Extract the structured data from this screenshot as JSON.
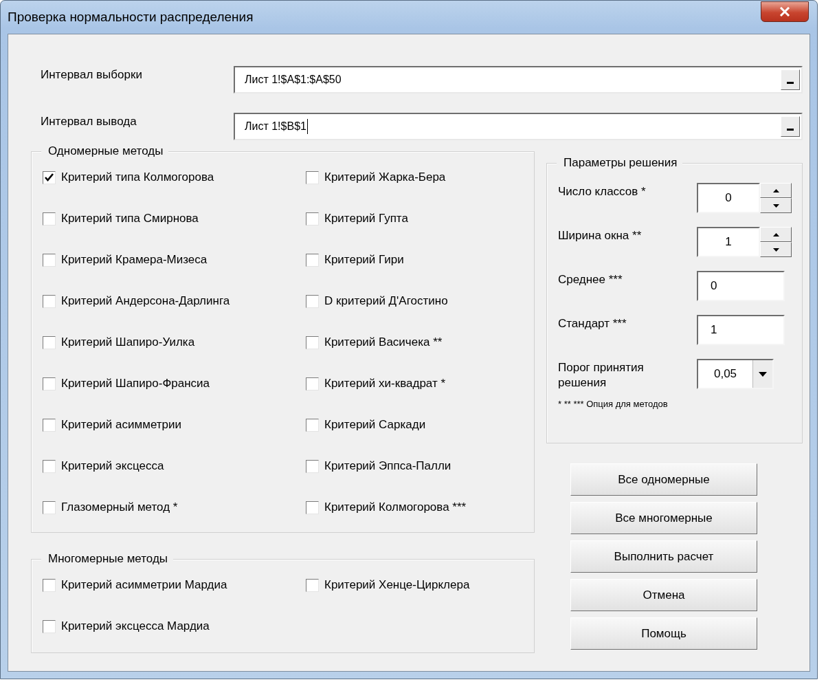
{
  "window": {
    "title": "Проверка нормальности распределения"
  },
  "fields": [
    {
      "label": "Интервал выборки",
      "value": "Лист 1!$A$1:$A$50",
      "focused": false
    },
    {
      "label": "Интервал вывода",
      "value": "Лист 1!$B$1",
      "focused": true
    }
  ],
  "univariate": {
    "title": "Одномерные методы",
    "items": [
      {
        "label": "Критерий типа Колмогорова",
        "checked": true
      },
      {
        "label": "Критерий Жарка-Бера",
        "checked": false
      },
      {
        "label": "Критерий типа Смирнова",
        "checked": false
      },
      {
        "label": "Критерий Гупта",
        "checked": false
      },
      {
        "label": "Критерий Крамера-Мизеса",
        "checked": false
      },
      {
        "label": "Критерий  Гири",
        "checked": false
      },
      {
        "label": "Критерий Андерсона-Дарлинга",
        "checked": false
      },
      {
        "label": "D критерий Д'Агостино",
        "checked": false
      },
      {
        "label": "Критерий Шапиро-Уилка",
        "checked": false
      },
      {
        "label": "Критерий Васичека **",
        "checked": false
      },
      {
        "label": "Критерий Шапиро-Франсиа",
        "checked": false
      },
      {
        "label": "Критерий хи-квадрат *",
        "checked": false
      },
      {
        "label": "Критерий асимметрии",
        "checked": false
      },
      {
        "label": "Критерий Саркади",
        "checked": false
      },
      {
        "label": "Критерий эксцесса",
        "checked": false
      },
      {
        "label": "Критерий Эппса-Палли",
        "checked": false
      },
      {
        "label": "Глазомерный метод *",
        "checked": false
      },
      {
        "label": "Критерий Колмогорова ***",
        "checked": false
      }
    ]
  },
  "multivariate": {
    "title": "Многомерные методы",
    "items": [
      {
        "label": "Критерий асимметрии Мардиа",
        "checked": false
      },
      {
        "label": "Критерий Хенце-Цирклера",
        "checked": false
      },
      {
        "label": "Критерий эксцесса Мардиа",
        "checked": false
      }
    ]
  },
  "parameters": {
    "title": "Параметры решения",
    "rows": [
      {
        "kind": "spinner",
        "label": "Число классов *",
        "value": "0"
      },
      {
        "kind": "spinner",
        "label": "Ширина окна **",
        "value": "1"
      },
      {
        "kind": "text",
        "label": "Среднее ***",
        "value": "0"
      },
      {
        "kind": "text",
        "label": "Стандарт ***",
        "value": "1"
      },
      {
        "kind": "dropdown",
        "label": "Порог принятия решения",
        "value": "0,05"
      }
    ],
    "footnote": "* ** *** Опция для методов"
  },
  "buttons": [
    "Все одномерные",
    "Все многомерные",
    "Выполнить расчет",
    "Отмена",
    "Помощь"
  ]
}
